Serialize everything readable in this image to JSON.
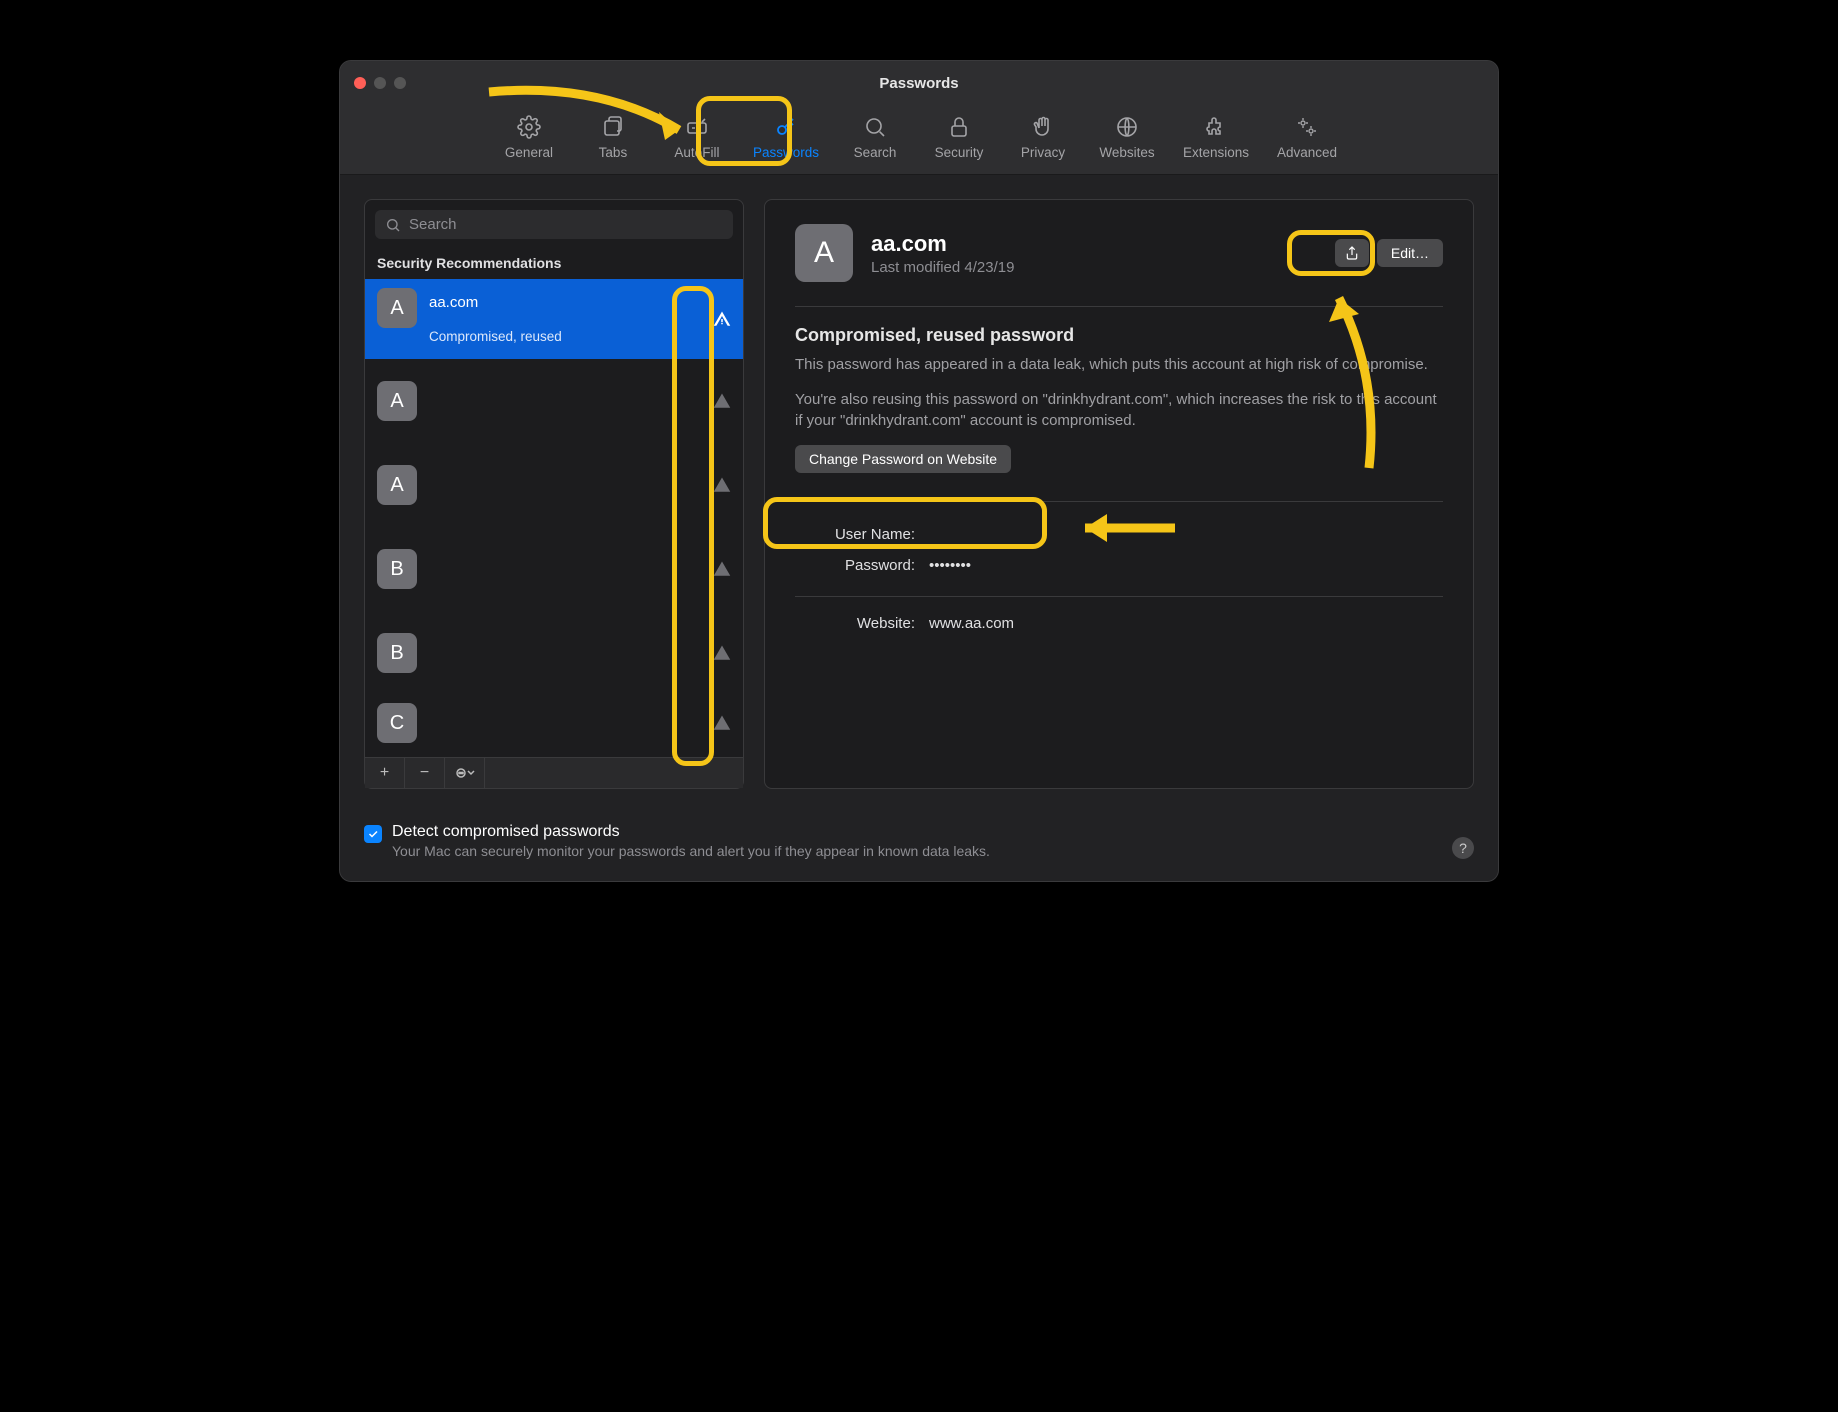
{
  "window": {
    "title": "Passwords"
  },
  "toolbar": {
    "items": [
      {
        "label": "General"
      },
      {
        "label": "Tabs"
      },
      {
        "label": "AutoFill"
      },
      {
        "label": "Passwords"
      },
      {
        "label": "Search"
      },
      {
        "label": "Security"
      },
      {
        "label": "Privacy"
      },
      {
        "label": "Websites"
      },
      {
        "label": "Extensions"
      },
      {
        "label": "Advanced"
      }
    ]
  },
  "search": {
    "placeholder": "Search"
  },
  "sidebar": {
    "section_header": "Security Recommendations",
    "rows": [
      {
        "letter": "A",
        "title": "aa.com",
        "sub": "Compromised, reused"
      },
      {
        "letter": "A",
        "title": "",
        "sub": ""
      },
      {
        "letter": "A",
        "title": "",
        "sub": ""
      },
      {
        "letter": "B",
        "title": "",
        "sub": ""
      },
      {
        "letter": "B",
        "title": "",
        "sub": ""
      },
      {
        "letter": "C",
        "title": "",
        "sub": ""
      }
    ]
  },
  "footer": {
    "add": "+",
    "remove": "−",
    "more": "⊙⌄"
  },
  "detail": {
    "avatar_letter": "A",
    "title": "aa.com",
    "subtitle": "Last modified 4/23/19",
    "share_label": "Share",
    "edit_label": "Edit…",
    "warning_title": "Compromised, reused password",
    "warning_text1": "This password has appeared in a data leak, which puts this account at high risk of compromise.",
    "warning_text2": "You're also reusing this password on \"drinkhydrant.com\", which increases the risk to this account if your \"drinkhydrant.com\" account is compromised.",
    "change_button": "Change Password on Website",
    "fields": {
      "username_label": "User Name:",
      "username_value": "",
      "password_label": "Password:",
      "password_value": "••••••••",
      "website_label": "Website:",
      "website_value": "www.aa.com"
    }
  },
  "detect": {
    "label": "Detect compromised passwords",
    "sub": "Your Mac can securely monitor your passwords and alert you if they appear in known data leaks."
  },
  "help_label": "?"
}
